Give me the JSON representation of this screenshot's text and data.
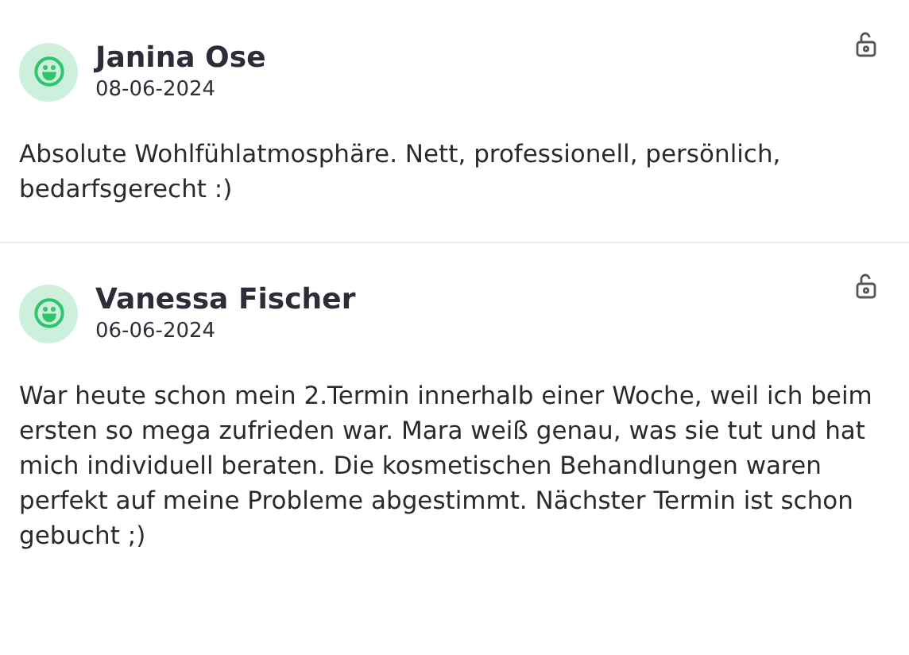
{
  "reviews": [
    {
      "name": "Janina Ose",
      "date": "08-06-2024",
      "text": "Absolute Wohlfühlatmosphäre. Nett, professionell, persönlich, bedarfsgerecht :)"
    },
    {
      "name": "Vanessa Fischer",
      "date": "06-06-2024",
      "text": "War heute schon mein 2.Termin innerhalb einer Woche, weil ich beim ersten so mega zufrieden war. Mara weiß genau, was sie tut und hat mich individuell beraten. Die kosmetischen Behandlungen waren perfekt auf meine Probleme abgestimmt. Nächster Termin ist schon gebucht ;)"
    }
  ]
}
